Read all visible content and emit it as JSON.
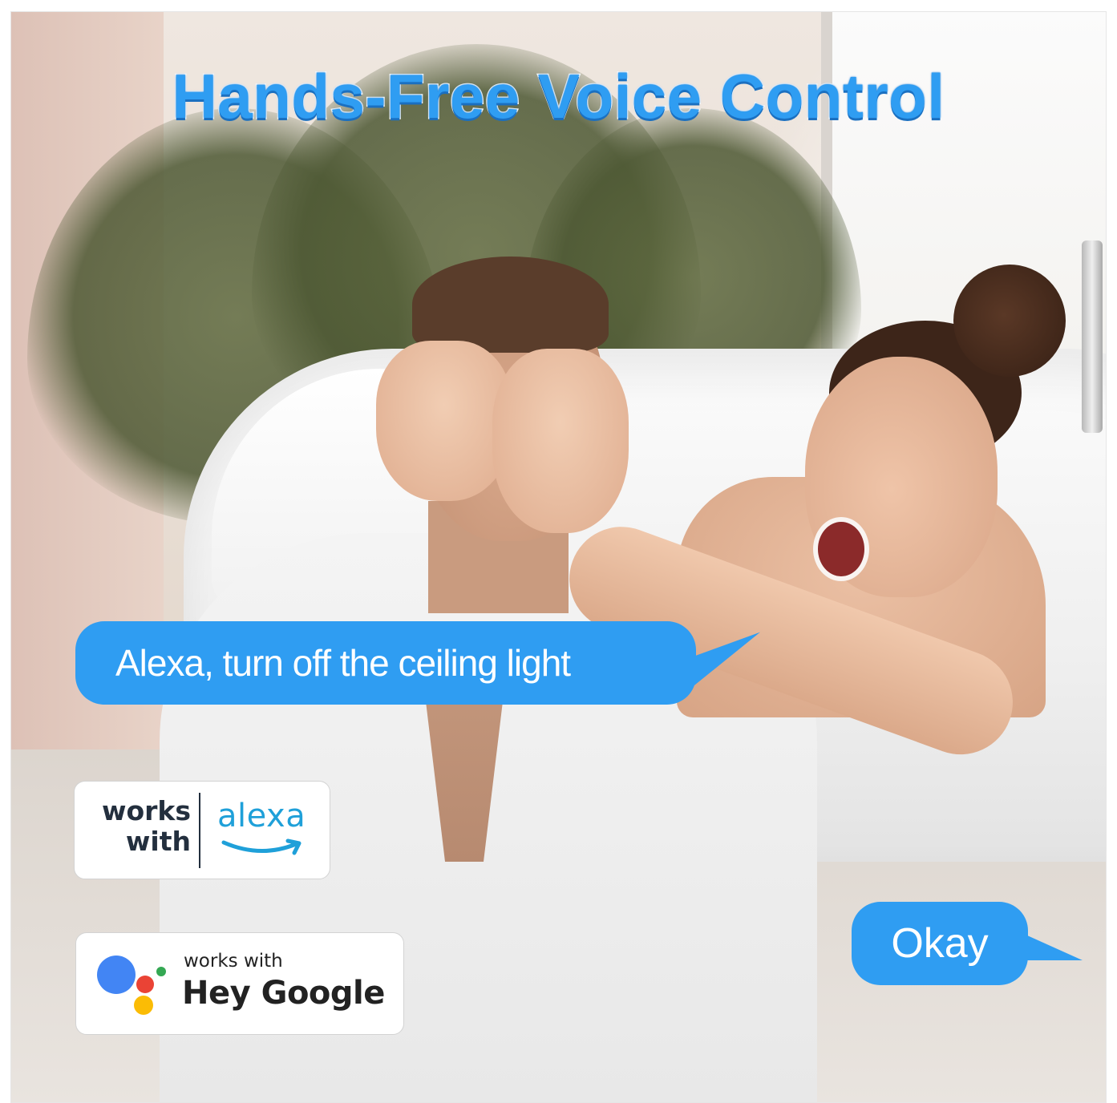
{
  "headline": "Hands-Free Voice Control",
  "speech": {
    "request": "Alexa, turn off the ceiling light",
    "reply": "Okay"
  },
  "badges": {
    "alexa": {
      "prefix": "works\nwith",
      "brand": "alexa"
    },
    "google": {
      "prefix": "works with",
      "brand": "Hey Google"
    }
  },
  "colors": {
    "bubble": "#2f9df2",
    "headline": "#2f9df2",
    "alexa_blue": "#1fa0d9",
    "google_blue": "#4285f4",
    "google_red": "#ea4335",
    "google_yellow": "#fbbc05",
    "google_green": "#34a853"
  },
  "icons": {
    "alexa_logo": "alexa-smile-logo",
    "google_logo": "google-assistant-dots-logo"
  }
}
